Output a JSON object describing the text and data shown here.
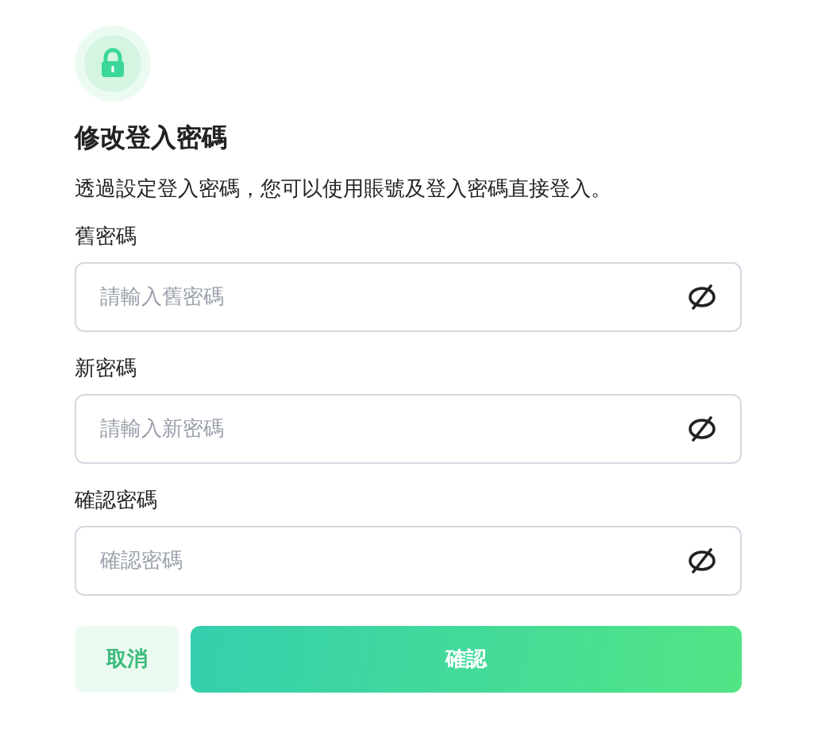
{
  "title": "修改登入密碼",
  "description": "透過設定登入密碼，您可以使用賬號及登入密碼直接登入。",
  "fields": [
    {
      "label": "舊密碼",
      "placeholder": "請輸入舊密碼"
    },
    {
      "label": "新密碼",
      "placeholder": "請輸入新密碼"
    },
    {
      "label": "確認密碼",
      "placeholder": "確認密碼"
    }
  ],
  "buttons": [
    {
      "kind": "secondary",
      "label": "取消"
    },
    {
      "kind": "primary",
      "label": "確認"
    }
  ]
}
